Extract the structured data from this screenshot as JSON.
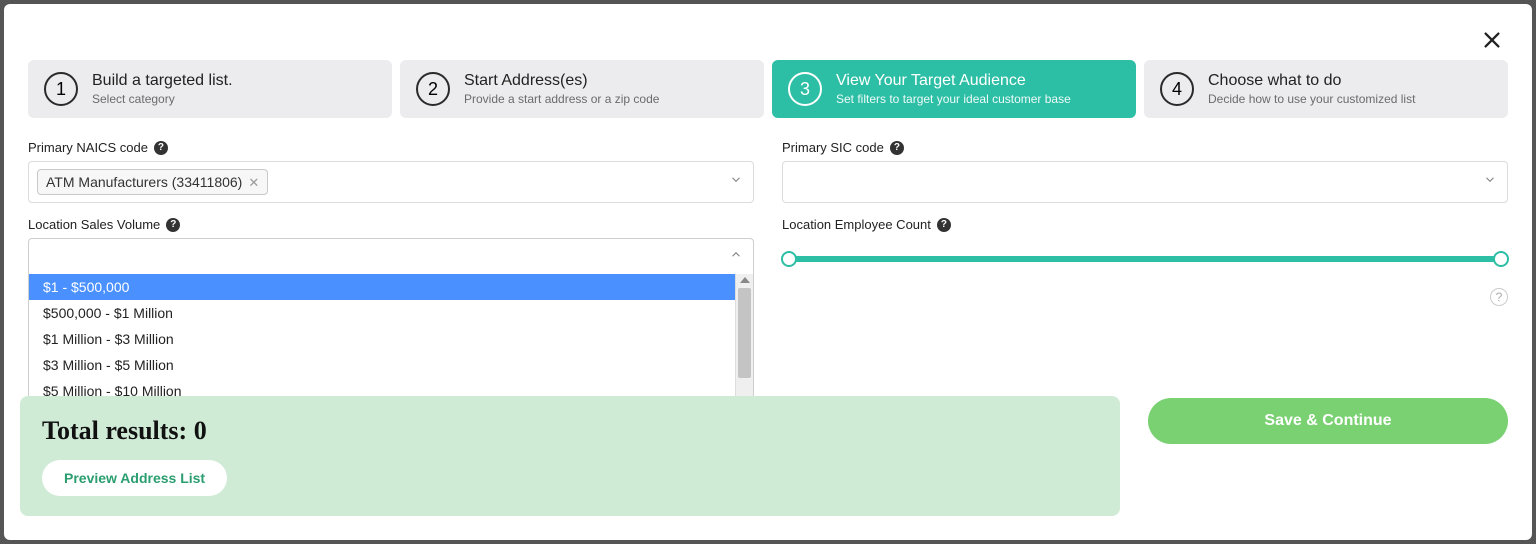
{
  "steps": [
    {
      "num": "1",
      "title": "Build a targeted list.",
      "sub": "Select category"
    },
    {
      "num": "2",
      "title": "Start Address(es)",
      "sub": "Provide a start address or a zip code"
    },
    {
      "num": "3",
      "title": "View Your Target Audience",
      "sub": "Set filters to target your ideal customer base"
    },
    {
      "num": "4",
      "title": "Choose what to do",
      "sub": "Decide how to use your customized list"
    }
  ],
  "labels": {
    "naics": "Primary NAICS code",
    "sic": "Primary SIC code",
    "salesVolume": "Location Sales Volume",
    "employeeCount": "Location Employee Count"
  },
  "naicsChips": [
    {
      "label": "ATM Manufacturers (33411806)"
    }
  ],
  "salesVolumeOptions": [
    "$1 - $500,000",
    "$500,000 - $1 Million",
    "$1 Million - $3 Million",
    "$3 Million - $5 Million",
    "$5 Million - $10 Million"
  ],
  "results": {
    "label": "Total results:",
    "count": "0",
    "previewLabel": "Preview Address List"
  },
  "buttons": {
    "save": "Save & Continue"
  }
}
